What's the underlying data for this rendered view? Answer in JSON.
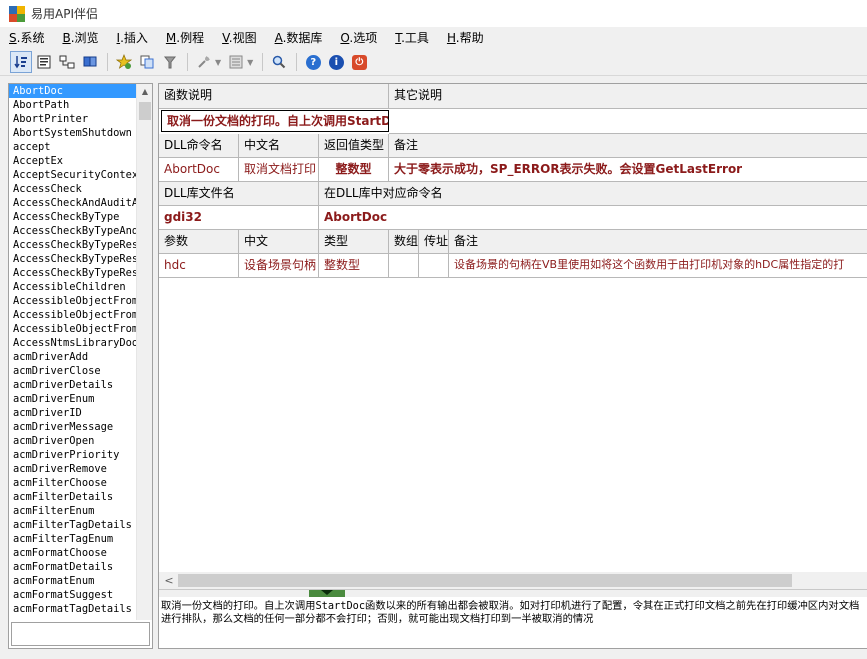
{
  "window": {
    "title": "易用API伴侣"
  },
  "menu": [
    {
      "acc": "S",
      "label": ".系统"
    },
    {
      "acc": "B",
      "label": ".浏览"
    },
    {
      "acc": "I",
      "label": ".插入"
    },
    {
      "acc": "M",
      "label": ".例程"
    },
    {
      "acc": "V",
      "label": ".视图"
    },
    {
      "acc": "A",
      "label": ".数据库"
    },
    {
      "acc": "O",
      "label": ".选项"
    },
    {
      "acc": "T",
      "label": ".工具"
    },
    {
      "acc": "H",
      "label": ".帮助"
    }
  ],
  "toolbar_icons": [
    "sort-icon",
    "book-icon",
    "tree-icon",
    "group-icon",
    "star-icon",
    "copy-icon",
    "wand-icon",
    "settings-icon",
    "layout-icon",
    "search-icon",
    "help-icon",
    "info-icon",
    "power-icon"
  ],
  "function_list": [
    "AbortDoc",
    "AbortPath",
    "AbortPrinter",
    "AbortSystemShutdown",
    "accept",
    "AcceptEx",
    "AcceptSecurityContex",
    "AccessCheck",
    "AccessCheckAndAuditA",
    "AccessCheckByType",
    "AccessCheckByTypeAnd",
    "AccessCheckByTypeRes",
    "AccessCheckByTypeRes",
    "AccessCheckByTypeRes",
    "AccessibleChildren",
    "AccessibleObjectFrom",
    "AccessibleObjectFrom",
    "AccessibleObjectFrom",
    "AccessNtmsLibraryDoo",
    "acmDriverAdd",
    "acmDriverClose",
    "acmDriverDetails",
    "acmDriverEnum",
    "acmDriverID",
    "acmDriverMessage",
    "acmDriverOpen",
    "acmDriverPriority",
    "acmDriverRemove",
    "acmFilterChoose",
    "acmFilterDetails",
    "acmFilterEnum",
    "acmFilterTagDetails",
    "acmFilterTagEnum",
    "acmFormatChoose",
    "acmFormatDetails",
    "acmFormatEnum",
    "acmFormatSuggest",
    "acmFormatTagDetails"
  ],
  "selected_index": 0,
  "search_value": "",
  "detail": {
    "desc_header": "函数说明",
    "other_header": "其它说明",
    "desc_value": "取消一份文档的打印。自上次调用StartDoc",
    "other_value": "",
    "h_dll_cmd": "DLL命令名",
    "h_cn_name": "中文名",
    "h_ret_type": "返回值类型",
    "h_remark": "备注",
    "dll_cmd": "AbortDoc",
    "cn_name": "取消文档打印",
    "ret_type": "整数型",
    "remark": "大于零表示成功，SP_ERROR表示失败。会设置GetLastError",
    "h_lib_file": "DLL库文件名",
    "h_lib_cmd": "在DLL库中对应命令名",
    "lib_file": "gdi32",
    "lib_cmd": "AbortDoc",
    "h_param": "参数",
    "h_param_cn": "中文",
    "h_param_type": "类型",
    "h_param_array": "数组",
    "h_param_ref": "传址",
    "h_param_remark": "备注",
    "param_name": "hdc",
    "param_cn": "设备场景句柄",
    "param_type": "整数型",
    "param_array": "",
    "param_ref": "",
    "param_remark": "设备场景的句柄在VB里使用如将这个函数用于由打印机对象的hDC属性指定的打"
  },
  "description_text": "取消一份文档的打印。自上次调用StartDoc函数以来的所有输出都会被取消。如对打印机进行了配置，令其在正式打印文档之前先在打印缓冲区内对文档进行排队，那么文档的任何一部分都不会打印；否则，就可能出现文档打印到一半被取消的情况"
}
